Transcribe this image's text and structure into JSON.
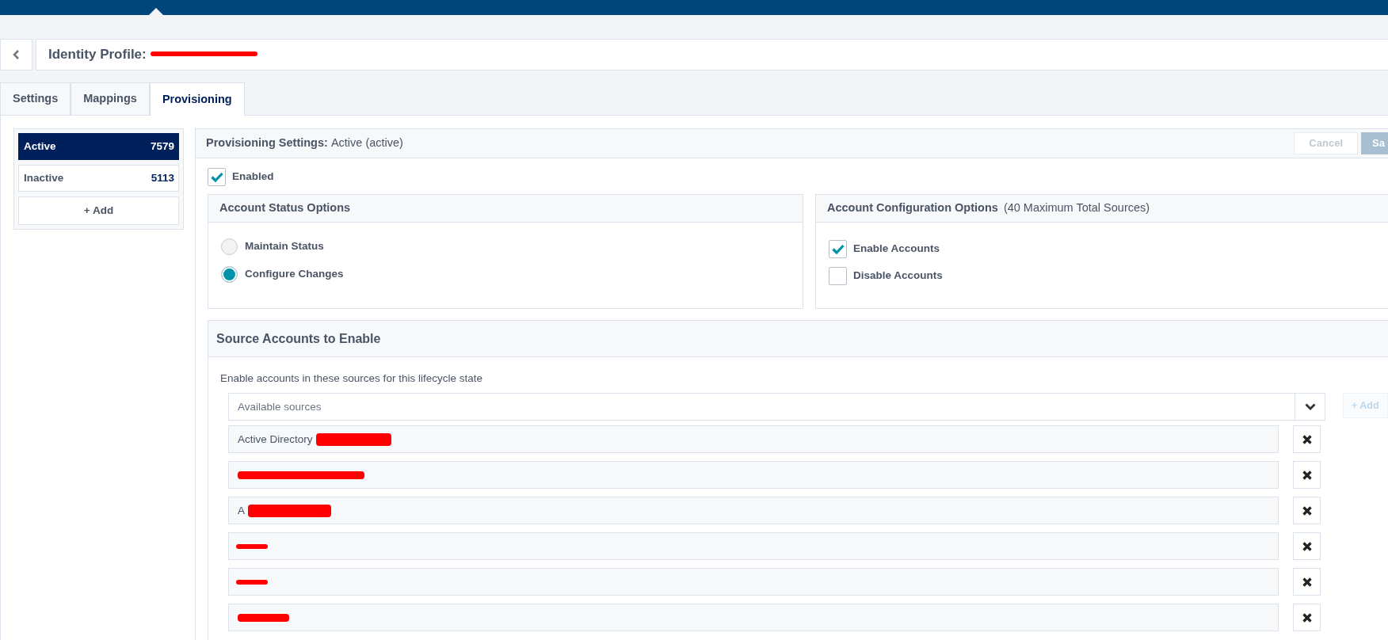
{
  "profile": {
    "label": "Identity Profile:",
    "name_covered": true
  },
  "tabs": [
    {
      "label": "Settings",
      "selected": false
    },
    {
      "label": "Mappings",
      "selected": false
    },
    {
      "label": "Provisioning",
      "selected": true
    }
  ],
  "states": [
    {
      "label": "Active",
      "count": "7579",
      "selected": true
    },
    {
      "label": "Inactive",
      "count": "5113",
      "selected": false
    }
  ],
  "add_state": "+ Add",
  "settings": {
    "title": "Provisioning Settings:",
    "subtitle": "Active (active)",
    "buttons": [
      {
        "label": "Cancel",
        "kind": "secondary"
      },
      {
        "label": "Sa",
        "kind": "primary"
      }
    ],
    "enabled": {
      "label": "Enabled",
      "checked": true
    }
  },
  "status_options": {
    "title": "Account Status Options",
    "options": [
      {
        "label": "Maintain Status",
        "selected": false
      },
      {
        "label": "Configure Changes",
        "selected": true
      }
    ]
  },
  "config_options": {
    "title": "Account Configuration Options",
    "note": "(40 Maximum Total Sources)",
    "options": [
      {
        "label": "Enable Accounts",
        "checked": true
      },
      {
        "label": "Disable Accounts",
        "checked": false
      }
    ]
  },
  "sources": {
    "title": "Source Accounts to Enable",
    "description": "Enable accounts in these sources for this lifecycle state",
    "picker": {
      "placeholder": "Available sources"
    },
    "add": "+ Add",
    "items": [
      {
        "label": "Active Directory",
        "kind": "covered"
      },
      {
        "kind": "covered"
      },
      {
        "label": "A",
        "kind": "covered"
      },
      {
        "kind": "struck"
      },
      {
        "kind": "struck"
      },
      {
        "kind": "covered"
      }
    ]
  }
}
